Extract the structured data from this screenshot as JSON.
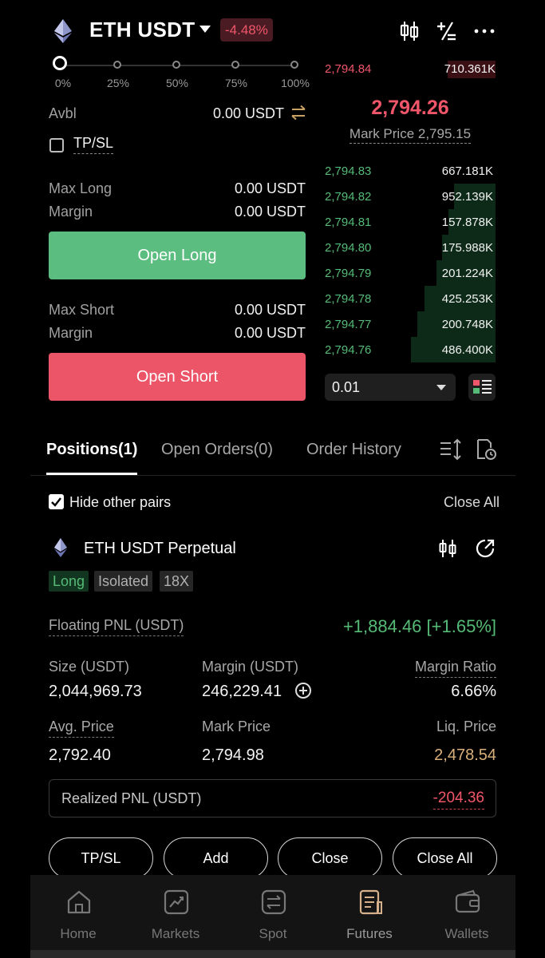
{
  "header": {
    "pair": "ETH USDT",
    "change": "-4.48%"
  },
  "slider": {
    "marks": [
      "0%",
      "25%",
      "50%",
      "75%",
      "100%"
    ]
  },
  "form": {
    "avbl_label": "Avbl",
    "avbl_value": "0.00 USDT",
    "tpsl_label": "TP/SL",
    "max_long_label": "Max Long",
    "max_long_value": "0.00 USDT",
    "long_margin_label": "Margin",
    "long_margin_value": "0.00 USDT",
    "open_long": "Open Long",
    "max_short_label": "Max Short",
    "max_short_value": "0.00 USDT",
    "short_margin_label": "Margin",
    "short_margin_value": "0.00 USDT",
    "open_short": "Open Short"
  },
  "orderbook": {
    "ask_top": {
      "price": "2,794.84",
      "qty": "710.361K"
    },
    "last_price": "2,794.26",
    "mark_price": "Mark Price 2,795.15",
    "bids": [
      {
        "price": "2,794.83",
        "qty": "667.181K",
        "depth": 0.0
      },
      {
        "price": "2,794.82",
        "qty": "952.139K",
        "depth": 0.49
      },
      {
        "price": "2,794.81",
        "qty": "157.878K",
        "depth": 0.56
      },
      {
        "price": "2,794.80",
        "qty": "175.988K",
        "depth": 0.63
      },
      {
        "price": "2,794.79",
        "qty": "201.224K",
        "depth": 0.7
      },
      {
        "price": "2,794.78",
        "qty": "425.253K",
        "depth": 0.84
      },
      {
        "price": "2,794.77",
        "qty": "200.748K",
        "depth": 0.92
      },
      {
        "price": "2,794.76",
        "qty": "486.400K",
        "depth": 1.0
      }
    ],
    "precision": "0.01"
  },
  "tabs": {
    "positions": "Positions(1)",
    "open_orders": "Open Orders(0)",
    "order_history": "Order History"
  },
  "positions": {
    "hide_other_pairs": "Hide other pairs",
    "close_all": "Close All",
    "title": "ETH USDT Perpetual",
    "tag_side": "Long",
    "tag_mode": "Isolated",
    "tag_leverage": "18X",
    "floating_pnl_label": "Floating PNL (USDT)",
    "floating_pnl_value": "+1,884.46 [+1.65%]",
    "size_label": "Size (USDT)",
    "size_value": "2,044,969.73",
    "margin_label": "Margin (USDT)",
    "margin_value": "246,229.41",
    "margin_ratio_label": "Margin Ratio",
    "margin_ratio_value": "6.66%",
    "avg_price_label": "Avg. Price",
    "avg_price_value": "2,792.40",
    "mark_price_label": "Mark Price",
    "mark_price_value": "2,794.98",
    "liq_price_label": "Liq. Price",
    "liq_price_value": "2,478.54",
    "realized_pnl_label": "Realized PNL (USDT)",
    "realized_pnl_value": "-204.36",
    "actions": [
      "TP/SL",
      "Add",
      "Close",
      "Close All"
    ]
  },
  "nav": {
    "items": [
      "Home",
      "Markets",
      "Spot",
      "Futures",
      "Wallets"
    ],
    "active": "Futures"
  },
  "colors": {
    "green": "#55bb76",
    "red": "#f0566a",
    "long_button": "#5bbd7f",
    "short_button": "#ec5467"
  }
}
